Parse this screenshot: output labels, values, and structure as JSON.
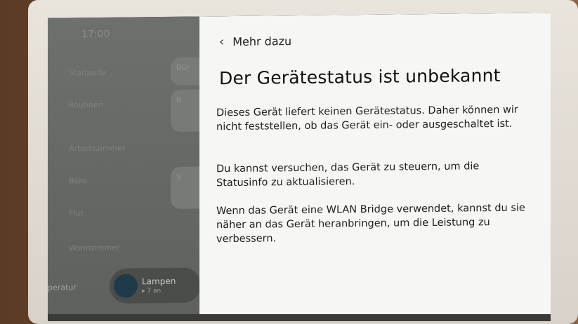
{
  "dashboard": {
    "time": "17:00",
    "nav": [
      "Startseite",
      "Routinen",
      "Arbeitszimmer",
      "Büro",
      "Flur",
      "Wohnzimmer"
    ],
    "chips": [
      "Bür",
      "B",
      "V"
    ],
    "temperature_label": "peratur",
    "lamp_card": {
      "name": "Lampen",
      "status": "▸ 7 an"
    }
  },
  "panel": {
    "back_label": "Mehr dazu",
    "title": "Der Gerätestatus ist unbekannt",
    "paragraphs": [
      "Dieses Gerät liefert keinen Gerätestatus. Daher können wir nicht feststellen, ob das Gerät ein- oder ausgeschaltet ist.",
      "Du kannst versuchen, das Gerät zu steuern, um die Statusinfo zu aktualisieren.",
      "Wenn das Gerät eine WLAN Bridge verwendet, kannst du sie näher an das Gerät heranbringen, um die Leistung zu verbessern."
    ]
  },
  "colors": {
    "panel_bg": "#f6f6f4",
    "dim_bg": "#6d706d",
    "bezel": "#e3ddd4"
  },
  "icons": {
    "back": "chevron-left-icon",
    "lamp": "lamp-icon"
  }
}
